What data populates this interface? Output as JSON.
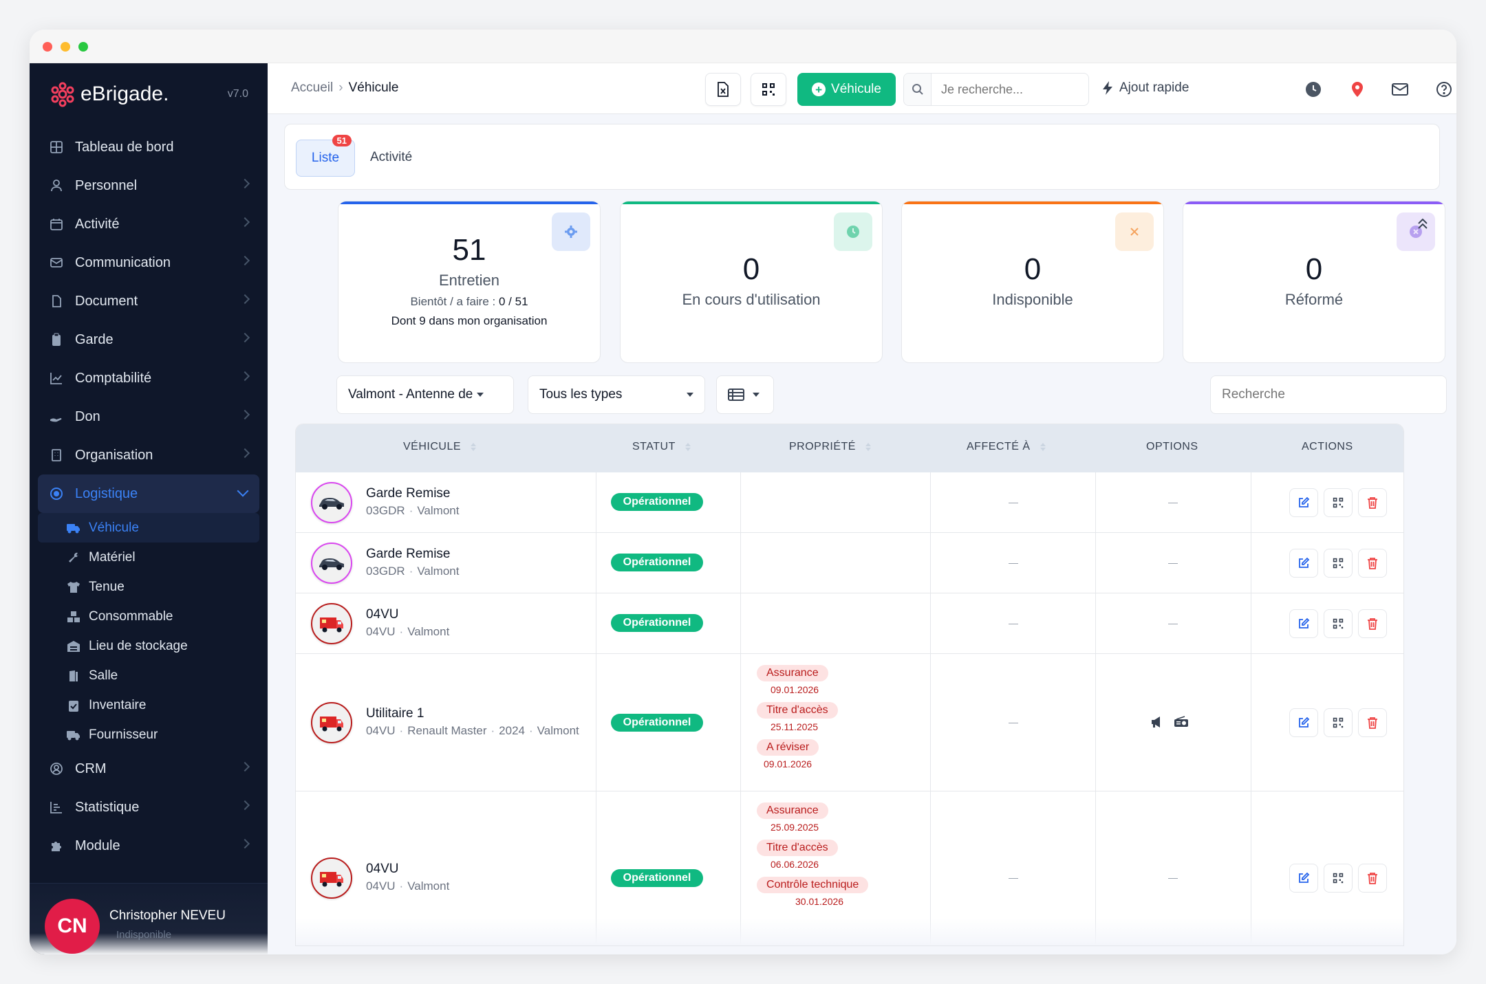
{
  "brand": {
    "name": "eBrigade.",
    "version": "v7.0"
  },
  "sidebar": {
    "items": [
      {
        "label": "Tableau de bord",
        "icon": "grid-icon"
      },
      {
        "label": "Personnel",
        "icon": "user-icon"
      },
      {
        "label": "Activité",
        "icon": "calendar-icon"
      },
      {
        "label": "Communication",
        "icon": "mail-icon"
      },
      {
        "label": "Document",
        "icon": "document-icon"
      },
      {
        "label": "Garde",
        "icon": "clipboard-icon"
      },
      {
        "label": "Comptabilité",
        "icon": "chart-line-icon"
      },
      {
        "label": "Don",
        "icon": "hand-icon"
      },
      {
        "label": "Organisation",
        "icon": "building-icon"
      }
    ],
    "active_group": {
      "label": "Logistique",
      "icon": "target-icon"
    },
    "sub_items": [
      {
        "label": "Véhicule",
        "icon": "truck-icon"
      },
      {
        "label": "Matériel",
        "icon": "wrench-icon"
      },
      {
        "label": "Tenue",
        "icon": "shirt-icon"
      },
      {
        "label": "Consommable",
        "icon": "boxes-icon"
      },
      {
        "label": "Lieu de stockage",
        "icon": "warehouse-icon"
      },
      {
        "label": "Salle",
        "icon": "door-icon"
      },
      {
        "label": "Inventaire",
        "icon": "clipboard-check-icon"
      },
      {
        "label": "Fournisseur",
        "icon": "truck-icon"
      }
    ],
    "bottom_items": [
      {
        "label": "CRM",
        "icon": "user-circle-icon"
      },
      {
        "label": "Statistique",
        "icon": "bar-chart-icon"
      },
      {
        "label": "Module",
        "icon": "puzzle-icon"
      }
    ],
    "user": {
      "initials": "CN",
      "name": "Christopher NEVEU",
      "status": "Indisponible"
    }
  },
  "topbar": {
    "breadcrumb": {
      "home": "Accueil",
      "current": "Véhicule"
    },
    "add_label": "Véhicule",
    "search_placeholder": "Je recherche...",
    "quick_add": "Ajout rapide"
  },
  "tabs": {
    "liste": "Liste",
    "liste_badge": "51",
    "activite": "Activité"
  },
  "stats": [
    {
      "value": "51",
      "label": "Entretien",
      "sub1": "Bientôt / a faire :",
      "sub1_value": "0 / 51",
      "sub2": "Dont 9 dans mon organisation",
      "color": "#2563eb"
    },
    {
      "value": "0",
      "label": "En cours d'utilisation",
      "color": "#10b981"
    },
    {
      "value": "0",
      "label": "Indisponible",
      "color": "#f97316"
    },
    {
      "value": "0",
      "label": "Réformé",
      "color": "#8b5cf6"
    }
  ],
  "filters": {
    "org": "Valmont - Antenne de",
    "type": "Tous les types",
    "search_placeholder": "Recherche"
  },
  "table": {
    "headers": [
      "VÉHICULE",
      "STATUT",
      "PROPRIÉTÉ",
      "AFFECTÉ À",
      "OPTIONS",
      "ACTIONS"
    ],
    "rows": [
      {
        "name": "Garde Remise",
        "code": "03GDR",
        "extra": "",
        "year": "",
        "org": "Valmont",
        "status": "Opérationnel"
      },
      {
        "name": "Garde Remise",
        "code": "03GDR",
        "extra": "",
        "year": "",
        "org": "Valmont",
        "status": "Opérationnel"
      },
      {
        "name": "04VU",
        "code": "04VU",
        "extra": "",
        "year": "",
        "org": "Valmont",
        "status": "Opérationnel"
      },
      {
        "name": "Utilitaire 1",
        "code": "04VU",
        "extra": "Renault Master",
        "year": "2024",
        "org": "Valmont",
        "status": "Opérationnel",
        "props": [
          {
            "tag": "Assurance",
            "date": "09.01.2026"
          },
          {
            "tag": "Titre d'accès",
            "date": "25.11.2025"
          },
          {
            "tag": "A réviser",
            "date": "09.01.2026"
          }
        ]
      },
      {
        "name": "04VU",
        "code": "04VU",
        "extra": "",
        "year": "",
        "org": "Valmont",
        "status": "Opérationnel",
        "props": [
          {
            "tag": "Assurance",
            "date": "25.09.2025"
          },
          {
            "tag": "Titre d'accès",
            "date": "06.06.2026"
          },
          {
            "tag": "Contrôle technique",
            "date": "30.01.2026"
          }
        ]
      }
    ]
  }
}
